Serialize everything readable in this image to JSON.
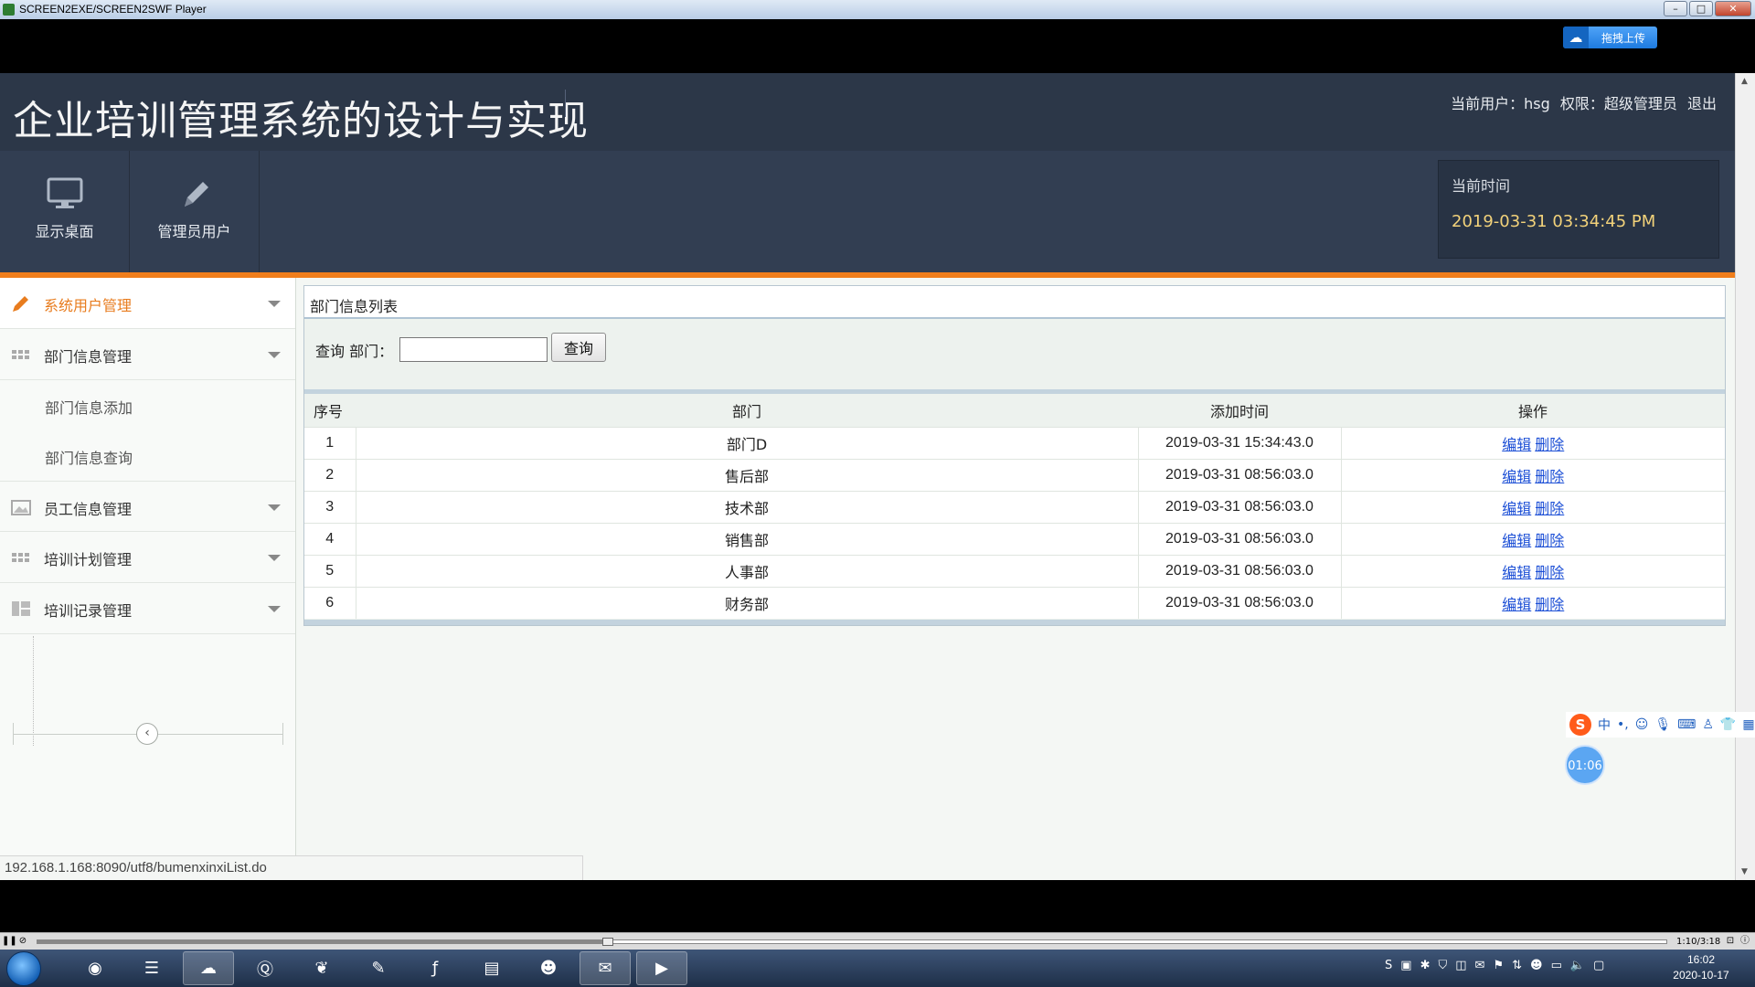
{
  "player": {
    "title": "SCREEN2EXE/SCREEN2SWF Player",
    "upload_label": "拖拽上传",
    "time_display": "1:10/3:18",
    "progress_fraction": 0.35
  },
  "app": {
    "title": "企业培训管理系统的设计与实现",
    "user_label": "当前用户：hsg",
    "role_label": "权限：超级管理员",
    "logout_label": "退出",
    "quick_buttons": [
      {
        "label": "显示桌面",
        "icon": "monitor-icon"
      },
      {
        "label": "管理员用户",
        "icon": "pencil-icon"
      }
    ],
    "time_box": {
      "label": "当前时间",
      "value": "2019-03-31 03:34:45 PM"
    }
  },
  "sidebar": {
    "menus": [
      {
        "label": "系统用户管理",
        "icon": "pencil-icon",
        "active": true
      },
      {
        "label": "部门信息管理",
        "icon": "grid-icon"
      },
      {
        "label": "员工信息管理",
        "icon": "picture-icon"
      },
      {
        "label": "培训计划管理",
        "icon": "grid-icon"
      },
      {
        "label": "培训记录管理",
        "icon": "list-icon"
      }
    ],
    "sub_items": [
      "部门信息添加",
      "部门信息查询"
    ],
    "collapse_symbol": "‹"
  },
  "panel": {
    "title": "部门信息列表",
    "search_label": "查询 部门：",
    "search_value": "",
    "search_button": "查询",
    "columns": [
      "序号",
      "部门",
      "添加时间",
      "操作"
    ],
    "rows": [
      {
        "no": "1",
        "dept": "部门D",
        "time": "2019-03-31 15:34:43.0",
        "edit": "编辑",
        "del": "删除"
      },
      {
        "no": "2",
        "dept": "售后部",
        "time": "2019-03-31 08:56:03.0",
        "edit": "编辑",
        "del": "删除"
      },
      {
        "no": "3",
        "dept": "技术部",
        "time": "2019-03-31 08:56:03.0",
        "edit": "编辑",
        "del": "删除"
      },
      {
        "no": "4",
        "dept": "销售部",
        "time": "2019-03-31 08:56:03.0",
        "edit": "编辑",
        "del": "删除"
      },
      {
        "no": "5",
        "dept": "人事部",
        "time": "2019-03-31 08:56:03.0",
        "edit": "编辑",
        "del": "删除"
      },
      {
        "no": "6",
        "dept": "财务部",
        "time": "2019-03-31 08:56:03.0",
        "edit": "编辑",
        "del": "删除"
      }
    ]
  },
  "status": {
    "url": "192.168.1.168:8090/utf8/bumenxinxiList.do"
  },
  "ime": {
    "mode": "中",
    "timer": "01:06"
  },
  "taskbar": {
    "time": "16:02",
    "date": "2020-10-17"
  },
  "colors": {
    "accent": "#f07e1c",
    "header": "#2c3748",
    "link": "#1c4fd6",
    "time_value": "#f2d27a"
  }
}
